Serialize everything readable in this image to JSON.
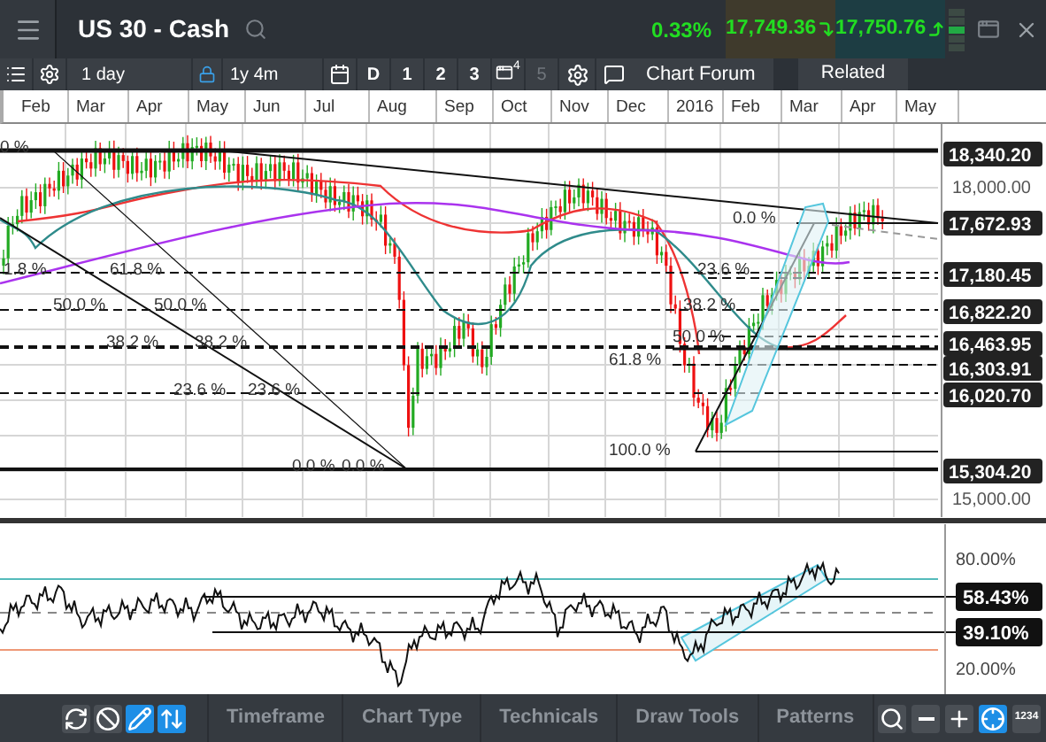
{
  "header": {
    "title": "US 30 - Cash",
    "change": "0.33%",
    "quotes": [
      {
        "kind": "sell",
        "price": "17,749.36",
        "rising": false
      },
      {
        "kind": "buy",
        "price": "17,750.76",
        "rising": true
      }
    ]
  },
  "toolbar": {
    "interval": "1 day",
    "range": "1y 4m",
    "layouts": [
      {
        "kind": "text",
        "label": "D",
        "disabled": false
      },
      {
        "kind": "text",
        "label": "1",
        "disabled": false
      },
      {
        "kind": "text",
        "label": "2",
        "disabled": false
      },
      {
        "kind": "text",
        "label": "3",
        "disabled": false
      },
      {
        "kind": "window",
        "label": "4",
        "disabled": false
      },
      {
        "kind": "text",
        "label": "5",
        "disabled": true
      }
    ],
    "forum_button": "Chart Forum",
    "related_button": "Related"
  },
  "months": [
    "Feb",
    "Mar",
    "Apr",
    "May",
    "Jun",
    "Jul",
    "Aug",
    "Sep",
    "Oct",
    "Nov",
    "Dec",
    "2016",
    "Feb",
    "Mar",
    "Apr",
    "May"
  ],
  "price_chart": {
    "fib_labels": [
      "0 %",
      "1.8 %",
      "61.8 %",
      "50.0 %",
      "50.0 %",
      "38.2 %",
      "38.2 %",
      "23.6 %",
      "23.6 %",
      "0.0 %",
      "0.0 %",
      "0.0 %",
      "23.6 %",
      "38.2 %",
      "50.0 %",
      "61.8 %",
      "100.0 %"
    ],
    "axis_ticks": [
      "18,000.00",
      "15,000.00"
    ],
    "price_tags": [
      "18,340.20",
      "17,672.93",
      "17,180.45",
      "16,822.20",
      "16,463.95",
      "16,303.91",
      "16,020.70",
      "15,304.20"
    ]
  },
  "rsi_chart": {
    "axis_ticks": [
      "80.00%",
      "20.00%"
    ],
    "level_tags": [
      "58.43%",
      "39.10%"
    ]
  },
  "bottom_bar": {
    "tools": [
      {
        "kind": "refresh",
        "selected": false
      },
      {
        "kind": "clear",
        "selected": false
      },
      {
        "kind": "pencil",
        "selected": true
      },
      {
        "kind": "updown",
        "selected": true
      }
    ],
    "menus": [
      "Timeframe",
      "Chart Type",
      "Technicals",
      "Draw Tools",
      "Patterns"
    ],
    "view_buttons": [
      {
        "kind": "zoom",
        "selected": false
      },
      {
        "kind": "minus",
        "selected": false
      },
      {
        "kind": "plus",
        "selected": false
      },
      {
        "kind": "crosshair",
        "selected": true
      },
      {
        "kind": "numbers",
        "label": "1234",
        "selected": false
      }
    ]
  }
}
